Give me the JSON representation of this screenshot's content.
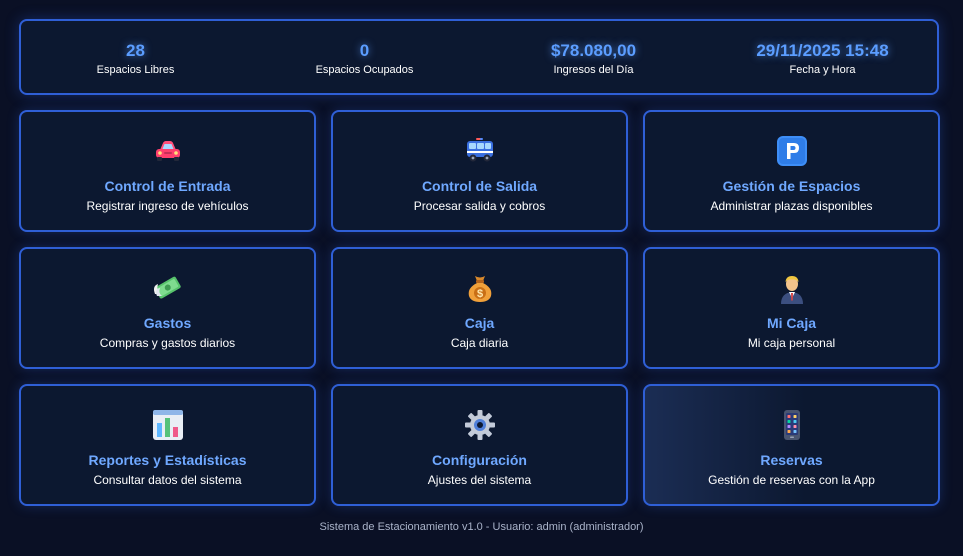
{
  "stats": [
    {
      "value": "28",
      "label": "Espacios Libres"
    },
    {
      "value": "0",
      "label": "Espacios Ocupados"
    },
    {
      "value": "$78.080,00",
      "label": "Ingresos del Día"
    },
    {
      "value": "29/11/2025 15:48",
      "label": "Fecha y Hora"
    }
  ],
  "cards": [
    {
      "icon": "car-icon",
      "title": "Control de Entrada",
      "desc": "Registrar ingreso de vehículos"
    },
    {
      "icon": "truck-icon",
      "title": "Control de Salida",
      "desc": "Procesar salida y cobros"
    },
    {
      "icon": "parking-icon",
      "title": "Gestión de Espacios",
      "desc": "Administrar plazas disponibles"
    },
    {
      "icon": "money-wings-icon",
      "title": "Gastos",
      "desc": "Compras y gastos diarios"
    },
    {
      "icon": "money-bag-icon",
      "title": "Caja",
      "desc": "Caja diaria"
    },
    {
      "icon": "person-icon",
      "title": "Mi Caja",
      "desc": "Mi caja personal"
    },
    {
      "icon": "bar-chart-icon",
      "title": "Reportes y Estadísticas",
      "desc": "Consultar datos del sistema"
    },
    {
      "icon": "gear-icon",
      "title": "Configuración",
      "desc": "Ajustes del sistema"
    },
    {
      "icon": "mobile-phone-icon",
      "title": "Reservas",
      "desc": "Gestión de reservas con la App"
    }
  ],
  "footer": "Sistema de Estacionamiento v1.0 - Usuario: admin (administrador)",
  "colors": {
    "background": "#0a1025",
    "panel": "#0c1830",
    "border": "#2f5fd6",
    "accent": "#5b9dff",
    "card_title": "#6fa8ff"
  }
}
